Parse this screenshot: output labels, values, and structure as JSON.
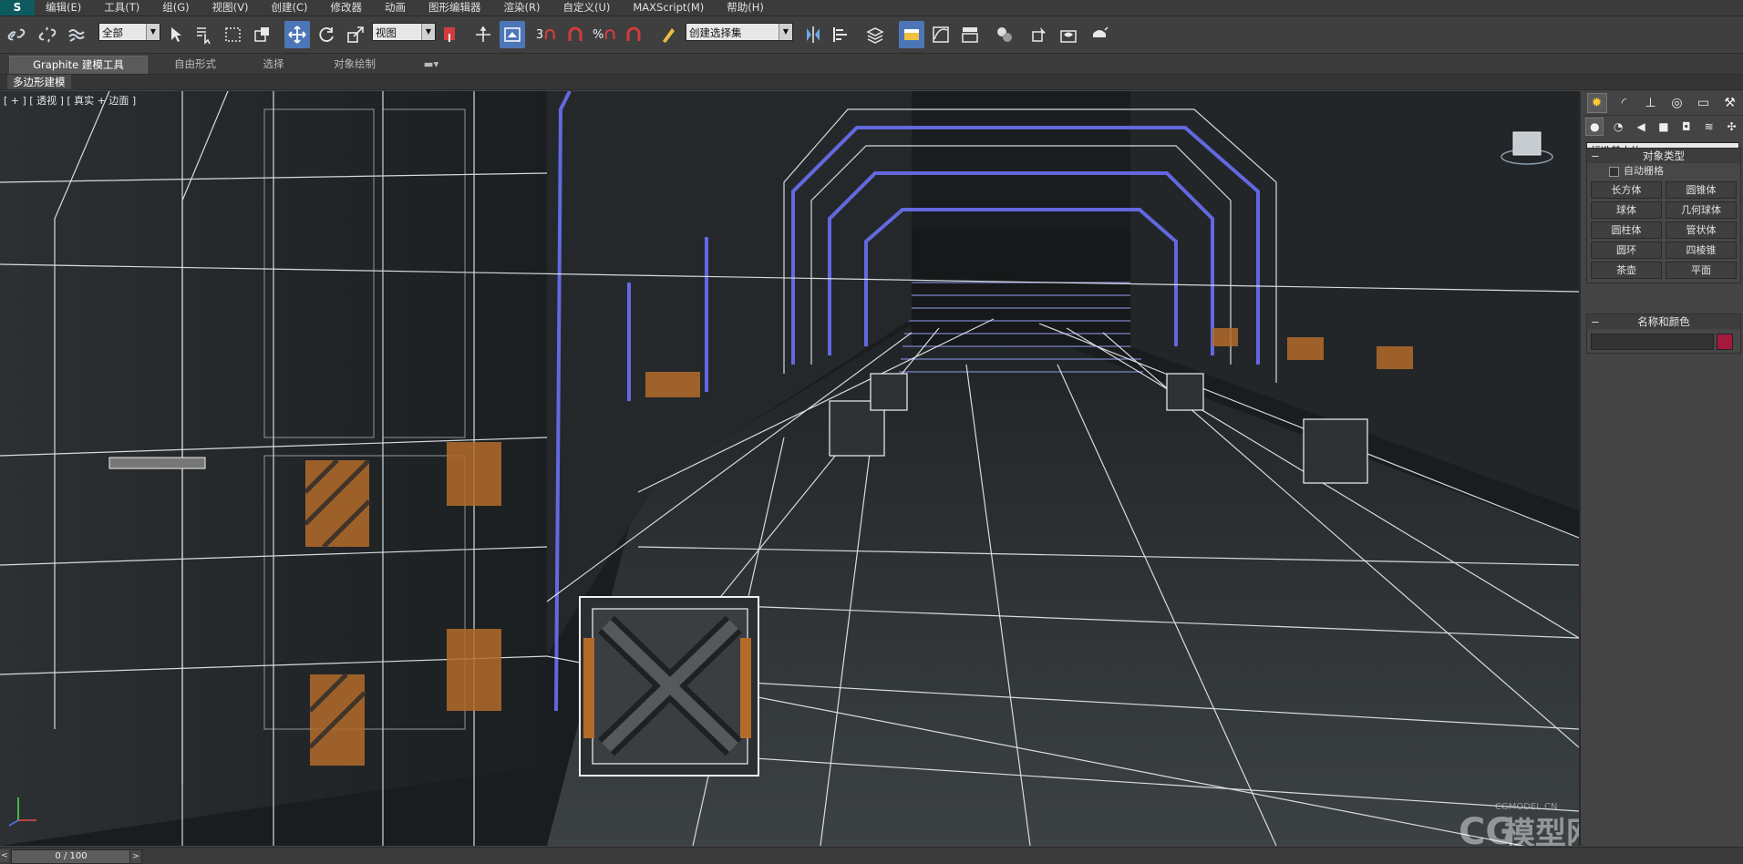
{
  "menu": {
    "logo": "S",
    "items": [
      "编辑(E)",
      "工具(T)",
      "组(G)",
      "视图(V)",
      "创建(C)",
      "修改器",
      "动画",
      "图形编辑器",
      "渲染(R)",
      "自定义(U)",
      "MAXScript(M)",
      "帮助(H)"
    ]
  },
  "toolbar": {
    "selection_filter": "全部",
    "reference_coord": "视图",
    "named_selection_sets": "创建选择集",
    "snap_label": "3",
    "angle_snap_label": "%"
  },
  "ribbon": {
    "tabs": [
      "Graphite 建模工具",
      "自由形式",
      "选择",
      "对象绘制"
    ],
    "sub_label": "多边形建模"
  },
  "viewport": {
    "label": "[ + ] [ 透视 ] [ 真实 + 边面 ]",
    "watermark": "模型网",
    "watermark_small": "CGMODEL.CN"
  },
  "command_panel": {
    "category": "标准基本体",
    "object_type_title": "对象类型",
    "autogrid_label": "自动栅格",
    "objects": [
      "长方体",
      "圆锥体",
      "球体",
      "几何球体",
      "圆柱体",
      "管状体",
      "圆环",
      "四棱锥",
      "茶壶",
      "平面"
    ],
    "name_color_title": "名称和颜色",
    "object_color": "#a4193c"
  },
  "statusbar": {
    "frame": "0 / 100"
  },
  "colors": {
    "active_button": "#4d76b8",
    "wire_blue": "#6f74ff"
  }
}
